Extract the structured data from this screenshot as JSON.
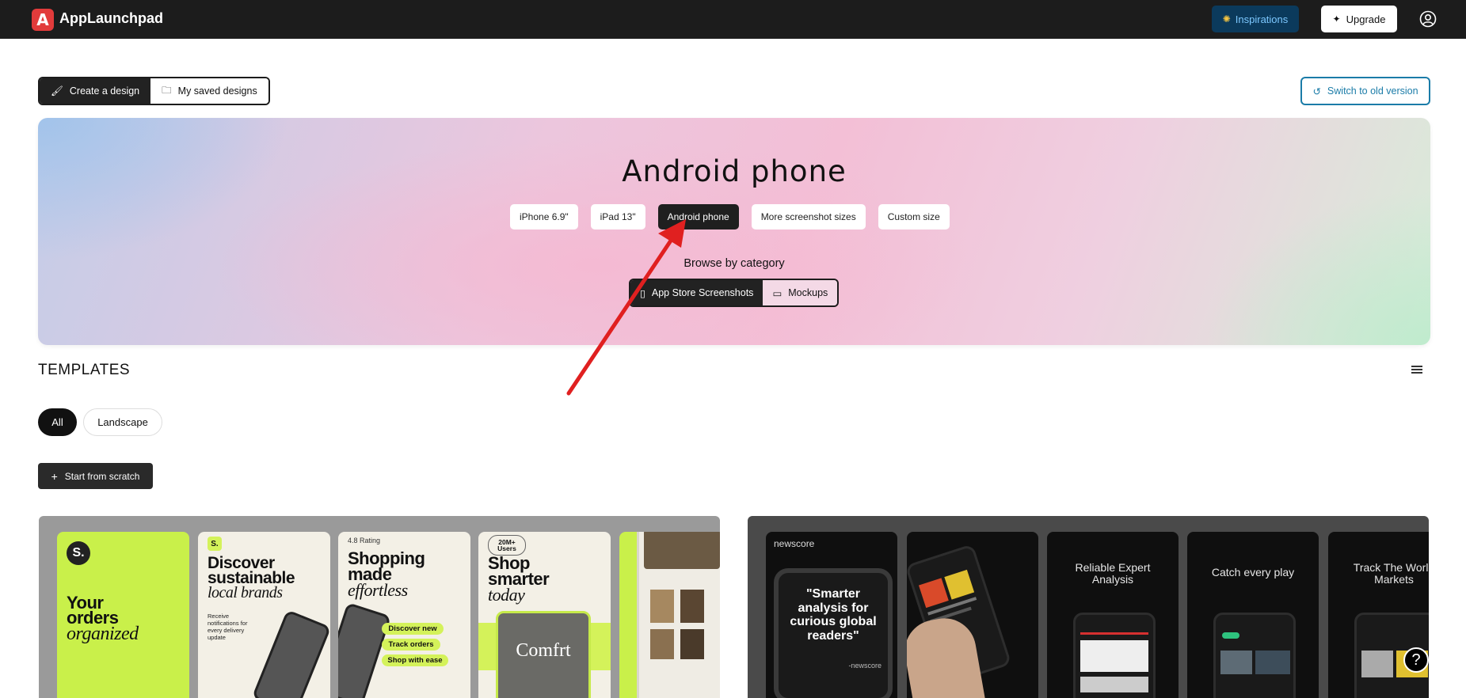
{
  "app": {
    "name": "AppLaunchpad",
    "logo_letter": "A"
  },
  "header": {
    "inspirations_label": "Inspirations",
    "upgrade_label": "Upgrade"
  },
  "mode": {
    "create_label": "Create a design",
    "saved_label": "My saved designs",
    "switch_label": "Switch to old version"
  },
  "hero": {
    "title": "Android phone",
    "sizes": [
      "iPhone 6.9\"",
      "iPad 13\"",
      "Android phone",
      "More screenshot sizes",
      "Custom size"
    ],
    "selected_size": "Android phone",
    "browse_label": "Browse by category",
    "categories": [
      "App Store Screenshots",
      "Mockups"
    ]
  },
  "templates": {
    "title": "TEMPLATES",
    "filters": [
      "All",
      "Landscape"
    ],
    "scratch_label": "Start from scratch"
  },
  "template_left": {
    "logo": "S.",
    "s1": [
      "Your",
      "orders",
      "organized"
    ],
    "s2": [
      "Discover",
      "sustainable",
      "local brands"
    ],
    "s2_note": "Receive notifications for every delivery update",
    "s3_rating": "4.8 Rating",
    "s3": [
      "Shopping",
      "made",
      "effortless"
    ],
    "s3_pills": [
      "Discover new",
      "Track orders",
      "Shop with ease"
    ],
    "s4_badge": "20M+ Users",
    "s4": [
      "Shop",
      "smarter",
      "today"
    ],
    "s4_brand": "Comfrt"
  },
  "template_right": {
    "brand": "newscore",
    "quote": "\"Smarter analysis for curious global readers\"",
    "quote_sign": "-newscore",
    "titles": [
      "Reliable Expert Analysis",
      "Catch every play",
      "Track The World Markets"
    ]
  },
  "colors": {
    "accent_lime": "#d4f25a",
    "annotation_red": "#e02020",
    "link_blue": "#1b7ca8"
  }
}
